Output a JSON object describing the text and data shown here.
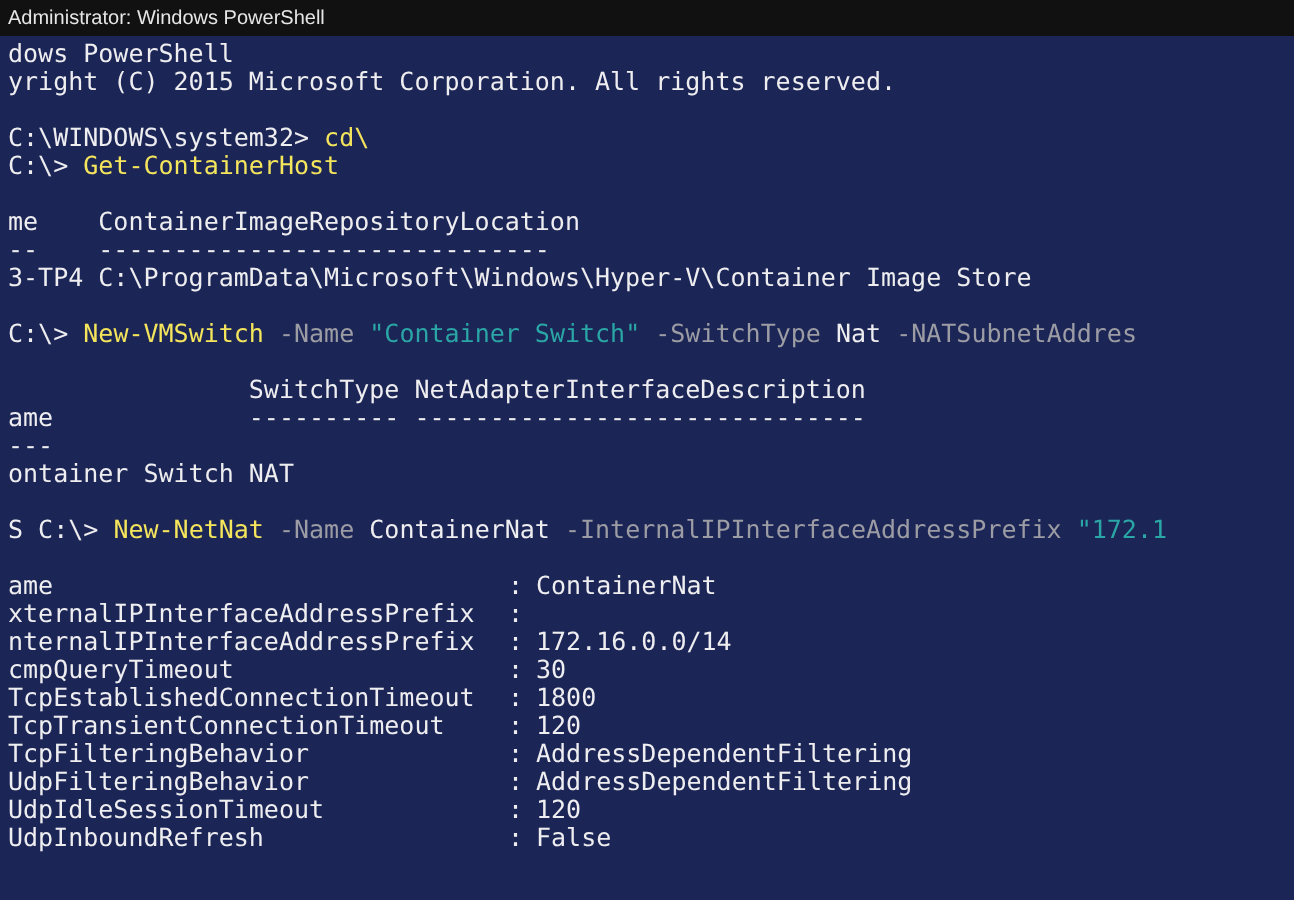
{
  "window": {
    "title": "Administrator: Windows PowerShell"
  },
  "console": {
    "lines": [
      {
        "kind": "text",
        "segments": [
          {
            "kind": "plain",
            "text": "dows PowerShell"
          }
        ]
      },
      {
        "kind": "text",
        "segments": [
          {
            "kind": "plain",
            "text": "yright (C) 2015 Microsoft Corporation. All rights reserved."
          }
        ]
      },
      {
        "kind": "blank"
      },
      {
        "kind": "text",
        "segments": [
          {
            "kind": "plain",
            "text": "C:\\WINDOWS\\system32> "
          },
          {
            "kind": "command",
            "text": "cd\\"
          }
        ]
      },
      {
        "kind": "text",
        "segments": [
          {
            "kind": "plain",
            "text": "C:\\> "
          },
          {
            "kind": "command",
            "text": "Get-ContainerHost"
          }
        ]
      },
      {
        "kind": "blank"
      },
      {
        "kind": "text",
        "segments": [
          {
            "kind": "plain",
            "text": "me    ContainerImageRepositoryLocation"
          }
        ]
      },
      {
        "kind": "text",
        "segments": [
          {
            "kind": "plain",
            "text": "--    ------------------------------"
          }
        ]
      },
      {
        "kind": "text",
        "segments": [
          {
            "kind": "plain",
            "text": "3-TP4 C:\\ProgramData\\Microsoft\\Windows\\Hyper-V\\Container Image Store"
          }
        ]
      },
      {
        "kind": "blank"
      },
      {
        "kind": "text",
        "segments": [
          {
            "kind": "plain",
            "text": "C:\\> "
          },
          {
            "kind": "command",
            "text": "New-VMSwitch"
          },
          {
            "kind": "param",
            "text": " -Name "
          },
          {
            "kind": "string",
            "text": "\"Container Switch\""
          },
          {
            "kind": "param",
            "text": " -SwitchType "
          },
          {
            "kind": "plain",
            "text": "Nat "
          },
          {
            "kind": "param",
            "text": "-NATSubnetAddres"
          }
        ]
      },
      {
        "kind": "blank"
      },
      {
        "kind": "text",
        "segments": [
          {
            "kind": "plain",
            "text": "                SwitchType NetAdapterInterfaceDescription"
          }
        ]
      },
      {
        "kind": "text",
        "segments": [
          {
            "kind": "plain",
            "text": "ame             ---------- ------------------------------"
          }
        ]
      },
      {
        "kind": "text",
        "segments": [
          {
            "kind": "plain",
            "text": "---"
          }
        ]
      },
      {
        "kind": "text",
        "segments": [
          {
            "kind": "plain",
            "text": "ontainer Switch NAT"
          }
        ]
      },
      {
        "kind": "blank"
      },
      {
        "kind": "text",
        "segments": [
          {
            "kind": "plain",
            "text": "S C:\\> "
          },
          {
            "kind": "command",
            "text": "New-NetNat"
          },
          {
            "kind": "param",
            "text": " -Name "
          },
          {
            "kind": "plain",
            "text": "ContainerNat "
          },
          {
            "kind": "param",
            "text": "-InternalIPInterfaceAddressPrefix "
          },
          {
            "kind": "string",
            "text": "\"172.1"
          }
        ]
      },
      {
        "kind": "blank"
      }
    ],
    "properties": [
      {
        "name": "ame",
        "colon": ":",
        "value": "ContainerNat"
      },
      {
        "name": "xternalIPInterfaceAddressPrefix",
        "colon": ":"
      },
      {
        "name": "nternalIPInterfaceAddressPrefix",
        "colon": ":",
        "value": "172.16.0.0/14"
      },
      {
        "name": "cmpQueryTimeout",
        "colon": ":",
        "value": "30"
      },
      {
        "name": "TcpEstablishedConnectionTimeout",
        "colon": ":",
        "value": "1800"
      },
      {
        "name": "TcpTransientConnectionTimeout",
        "colon": ":",
        "value": "120"
      },
      {
        "name": "TcpFilteringBehavior",
        "colon": ":",
        "value": "AddressDependentFiltering"
      },
      {
        "name": "UdpFilteringBehavior",
        "colon": ":",
        "value": "AddressDependentFiltering"
      },
      {
        "name": "UdpIdleSessionTimeout",
        "colon": ":",
        "value": "120"
      },
      {
        "name": "UdpInboundRefresh",
        "colon": ":",
        "value": "False"
      }
    ]
  }
}
